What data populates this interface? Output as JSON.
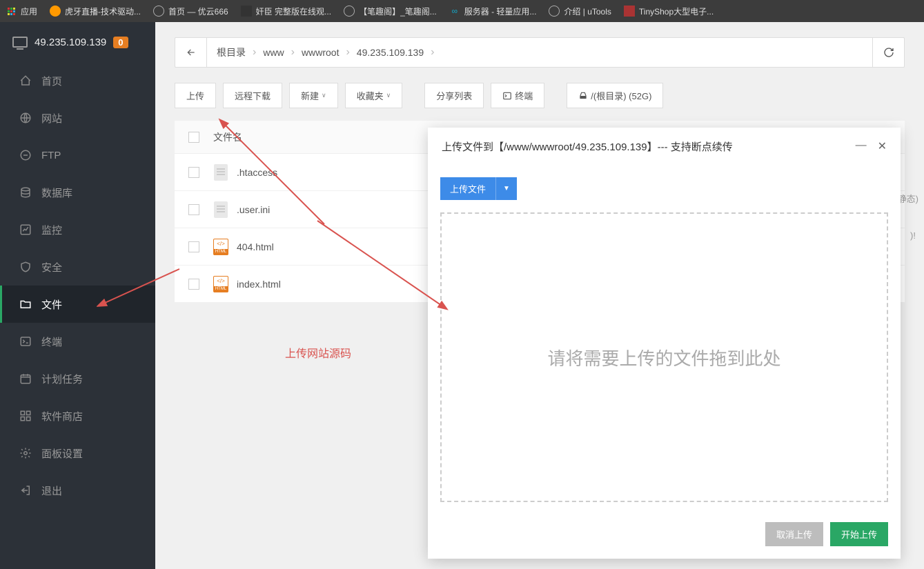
{
  "bookmarks": [
    {
      "label": "应用"
    },
    {
      "label": "虎牙直播-技术驱动..."
    },
    {
      "label": "首页 — 优云666"
    },
    {
      "label": "奸臣 完整版在线观..."
    },
    {
      "label": "【笔趣阁】_笔趣阁..."
    },
    {
      "label": "服务器 - 轻量应用..."
    },
    {
      "label": "介绍 | uTools"
    },
    {
      "label": "TinyShop大型电子..."
    }
  ],
  "sidebar": {
    "ip": "49.235.109.139",
    "badge": "0",
    "items": [
      {
        "label": "首页"
      },
      {
        "label": "网站"
      },
      {
        "label": "FTP"
      },
      {
        "label": "数据库"
      },
      {
        "label": "监控"
      },
      {
        "label": "安全"
      },
      {
        "label": "文件"
      },
      {
        "label": "终端"
      },
      {
        "label": "计划任务"
      },
      {
        "label": "软件商店"
      },
      {
        "label": "面板设置"
      },
      {
        "label": "退出"
      }
    ]
  },
  "breadcrumb": [
    "根目录",
    "www",
    "wwwroot",
    "49.235.109.139"
  ],
  "toolbar": {
    "upload": "上传",
    "remote_download": "远程下载",
    "new": "新建",
    "favorites": "收藏夹",
    "share_list": "分享列表",
    "terminal": "终端",
    "root_disk": "/(根目录) (52G)"
  },
  "table": {
    "header_filename": "文件名",
    "rows": [
      {
        "name": ".htaccess",
        "type": "doc"
      },
      {
        "name": ".user.ini",
        "type": "doc"
      },
      {
        "name": "404.html",
        "type": "html"
      },
      {
        "name": "index.html",
        "type": "html"
      }
    ]
  },
  "annotation": "上传网站源码",
  "bg_hints": {
    "static": "静态)",
    "exclaim": ")!"
  },
  "dialog": {
    "title": "上传文件到【/www/wwwroot/49.235.109.139】--- 支持断点续传",
    "upload_file": "上传文件",
    "dropzone_text": "请将需要上传的文件拖到此处",
    "cancel": "取消上传",
    "start": "开始上传"
  }
}
